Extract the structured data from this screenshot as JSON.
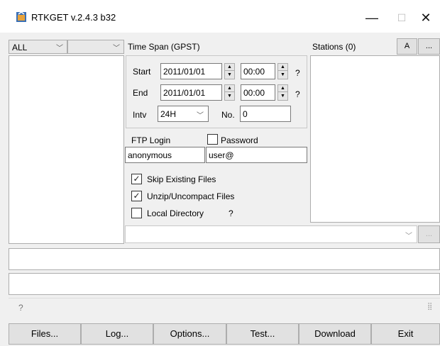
{
  "window": {
    "title": "RTKGET v.2.4.3 b32",
    "controls": {
      "minimize": "—",
      "maximize": "☐",
      "close": "✕"
    }
  },
  "left_panel": {
    "type_combo": "ALL",
    "sub_combo": ""
  },
  "time_span": {
    "label": "Time Span (GPST)",
    "start_label": "Start",
    "start_date": "2011/01/01",
    "start_time": "00:00",
    "end_label": "End",
    "end_date": "2011/01/01",
    "end_time": "00:00",
    "help": "?",
    "intv_label": "Intv",
    "intv_value": "24H",
    "no_label": "No.",
    "no_value": "0"
  },
  "ftp": {
    "login_label": "FTP Login",
    "password_label": "Password",
    "password_checked": false,
    "login_value": "anonymous",
    "password_value": "user@"
  },
  "options": {
    "skip_existing": {
      "label": "Skip Existing Files",
      "checked": true
    },
    "unzip": {
      "label": "Unzip/Uncompact Files",
      "checked": true
    },
    "local_dir": {
      "label": "Local Directory",
      "checked": false,
      "help": "?"
    }
  },
  "stations": {
    "label": "Stations (0)",
    "a_button": "A",
    "more_button": "..."
  },
  "directory": {
    "value": "",
    "browse_button": "..."
  },
  "status": {
    "message": "?",
    "grip": "⣿"
  },
  "buttons": {
    "files": "Files...",
    "log": "Log...",
    "options": "Options...",
    "test": "Test...",
    "download": "Download",
    "exit": "Exit"
  }
}
